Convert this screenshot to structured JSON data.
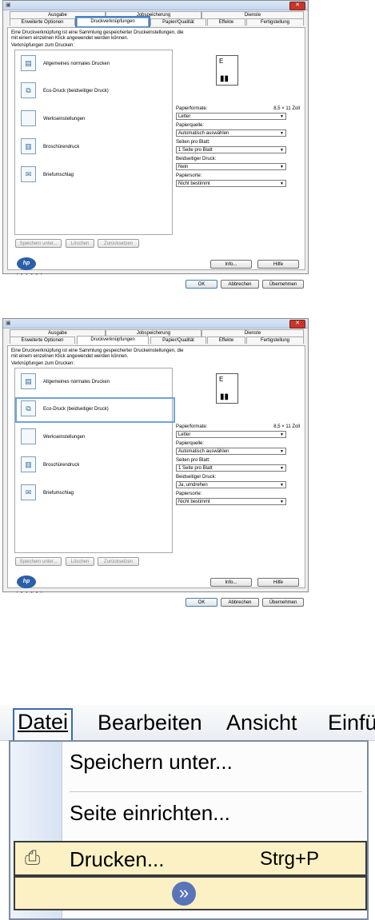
{
  "dialogs": [
    {
      "close_glyph": "✕",
      "tabs_row1": [
        "Ausgabe",
        "Jobspeicherung",
        "Dienste"
      ],
      "tabs_row2": [
        "Erweiterte Optionen",
        "Druckverknüpfungen",
        "Papier/Qualität",
        "Effekte",
        "Fertigstellung"
      ],
      "selected_tab": "Druckverknüpfungen",
      "description": "Eine Druckverknüpfung ist eine Sammlung gespeicherter Druckeinstellungen, die mit einem einzelnen Klick angewendet werden können.",
      "list_label": "Verknüpfungen zum Drucken:",
      "shortcuts": [
        "Allgemeines normales Drucken",
        "Eco-Druck (beidseitiger Druck)",
        "Werkseinstellungen",
        "Broschürendruck",
        "Briefumschlag"
      ],
      "highlighted_shortcut": 0,
      "paper_size_label": "Papierformate:",
      "paper_size_value": "8,5 × 11 Zoll",
      "paper_size_select": "Letter",
      "paper_source_label": "Papierquelle:",
      "paper_source_value": "Automatisch auswählen",
      "pages_per_sheet_label": "Seiten pro Blatt:",
      "pages_per_sheet_value": "1 Seite pro Blatt",
      "duplex_label": "Beidseitiger Druck:",
      "duplex_value": "Nein",
      "paper_type_label": "Papiersorte:",
      "paper_type_value": "Nicht bestimmt",
      "buttons": {
        "save_as": "Speichern unter...",
        "delete": "Löschen",
        "reset": "Zurücksetzen",
        "info": "Info...",
        "help": "Hilfe",
        "ok": "OK",
        "cancel": "Abbrechen",
        "apply": "Übernehmen"
      },
      "logo_text": "hp",
      "logo_subtext": "i n v e n t"
    },
    {
      "close_glyph": "✕",
      "tabs_row1": [
        "Ausgabe",
        "Jobspeicherung",
        "Dienste"
      ],
      "tabs_row2": [
        "Erweiterte Optionen",
        "Druckverknüpfungen",
        "Papier/Qualität",
        "Effekte",
        "Fertigstellung"
      ],
      "selected_tab": "Druckverknüpfungen",
      "description": "Eine Druckverknüpfung ist eine Sammlung gespeicherter Druckeinstellungen, die mit einem einzelnen Klick angewendet werden können.",
      "list_label": "Verknüpfungen zum Drucken:",
      "shortcuts": [
        "Allgemeines normales Drucken",
        "Eco-Druck (beidseitiger Druck)",
        "Werkseinstellungen",
        "Broschürendruck",
        "Briefumschlag"
      ],
      "highlighted_shortcut": 1,
      "paper_size_label": "Papierformate:",
      "paper_size_value": "8,5 × 11 Zoll",
      "paper_size_select": "Letter",
      "paper_source_label": "Papierquelle:",
      "paper_source_value": "Automatisch auswählen",
      "pages_per_sheet_label": "Seiten pro Blatt:",
      "pages_per_sheet_value": "1 Seite pro Blatt",
      "duplex_label": "Beidseitiger Druck:",
      "duplex_value": "Ja, umdrehen",
      "paper_type_label": "Papiersorte:",
      "paper_type_value": "Nicht bestimmt",
      "buttons": {
        "save_as": "Speichern unter...",
        "delete": "Löschen",
        "reset": "Zurücksetzen",
        "info": "Info...",
        "help": "Hilfe",
        "ok": "OK",
        "cancel": "Abbrechen",
        "apply": "Übernehmen"
      },
      "logo_text": "hp",
      "logo_subtext": "i n v e n t"
    }
  ],
  "menu": {
    "titles": [
      "Datei",
      "Bearbeiten",
      "Ansicht",
      "Einfü"
    ],
    "items": [
      {
        "label": "Speichern unter...",
        "shortcut": ""
      },
      {
        "label": "Seite einrichten...",
        "shortcut": ""
      },
      {
        "label": "Drucken...",
        "shortcut": "Strg+P"
      }
    ],
    "expand_glyph": "»"
  },
  "colors": {
    "highlight_blue": "#3b84d8",
    "menu_highlight": "#fbf1c4",
    "close_red": "#c7362a",
    "hp_blue": "#2b5fa8"
  }
}
